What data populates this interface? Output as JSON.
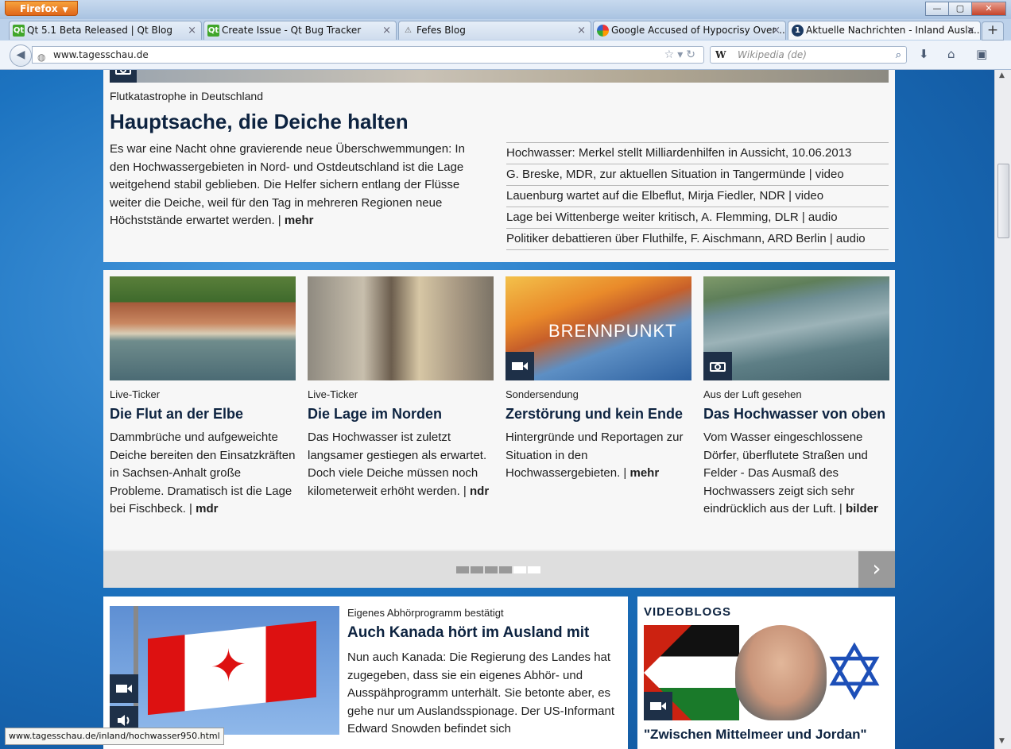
{
  "browser": {
    "menu_label": "Firefox",
    "window_controls": {
      "minimize": "—",
      "maximize": "▢",
      "close": "✕"
    },
    "tabs": [
      {
        "label": "Qt 5.1 Beta Released | Qt Blog",
        "icon": "qt-icon"
      },
      {
        "label": "Create Issue - Qt Bug Tracker",
        "icon": "qt-icon"
      },
      {
        "label": "Fefes Blog",
        "icon": "fefe-icon"
      },
      {
        "label": "Google Accused of Hypocrisy Over ...",
        "icon": "nbc-icon"
      },
      {
        "label": "Aktuelle Nachrichten - Inland Ausla...",
        "icon": "tagesschau-icon"
      }
    ],
    "new_tab_label": "+",
    "url": "www.tagesschau.de",
    "search_engine": "W",
    "search_placeholder": "Wikipedia (de)",
    "status_url": "www.tagesschau.de/inland/hochwasser950.html"
  },
  "lead": {
    "kicker": "Flutkatastrophe in Deutschland",
    "headline": "Hauptsache, die Deiche halten",
    "teaser": "Es war eine Nacht ohne gravierende neue Überschwemmungen: In den Hochwassergebieten in Nord- und Ostdeutschland ist die Lage weitgehend stabil geblieben. Die Helfer sichern entlang der Flüsse weiter die Deiche, weil für den Tag in mehreren Regionen neue Höchststände erwartet werden. |",
    "more": "mehr",
    "related": [
      "Hochwasser: Merkel stellt Milliardenhilfen in Aussicht, 10.06.2013",
      "G. Breske, MDR, zur aktuellen Situation in Tangermünde | video",
      "Lauenburg wartet auf die Elbeflut, Mirja Fiedler, NDR | video",
      "Lage bei Wittenberge weiter kritisch, A. Flemming, DLR | audio",
      "Politiker debattieren über Fluthilfe, F. Aischmann, ARD Berlin | audio"
    ]
  },
  "cards": [
    {
      "kicker": "Live-Ticker",
      "title": "Die Flut an der Elbe",
      "teaser": "Dammbrüche und aufgeweichte Deiche bereiten den Einsatzkräften in Sachsen-Anhalt große Probleme. Dramatisch ist die Lage bei Fischbeck. |",
      "more": "mdr"
    },
    {
      "kicker": "Live-Ticker",
      "title": "Die Lage im Norden",
      "teaser": "Das Hochwasser ist zuletzt langsamer gestiegen als erwartet. Doch viele Deiche müssen noch kilometerweit erhöht werden. |",
      "more": "ndr"
    },
    {
      "kicker": "Sondersendung",
      "title": "Zerstörung und kein Ende",
      "teaser": "Hintergründe und Reportagen zur Situation in den Hochwassergebieten. |",
      "more": "mehr",
      "image_text": "BRENNPUNKT"
    },
    {
      "kicker": "Aus der Luft gesehen",
      "title": "Das Hochwasser von oben",
      "teaser": "Vom Wasser eingeschlossene Dörfer, überflutete Straßen und Felder - Das Ausmaß des Hochwassers zeigt sich sehr eindrücklich aus der Luft. |",
      "more": "bilder"
    }
  ],
  "pager": {
    "total_pages": 6,
    "active_pages": [
      5,
      6
    ],
    "next": "›"
  },
  "canada": {
    "kicker": "Eigenes Abhörprogramm bestätigt",
    "headline": "Auch Kanada hört im Ausland mit",
    "teaser": "Nun auch Kanada: Die Regierung des Landes hat zugegeben, dass sie ein eigenes Abhör- und Ausspähprogramm unterhält. Sie betonte aber, es gehe nur um Auslandsspionage. Der US-Informant Edward Snowden befindet sich"
  },
  "videoblogs": {
    "heading": "VIDEOBLOGS",
    "caption": "\"Zwischen Mittelmeer und Jordan\""
  },
  "colors": {
    "headline": "#0d2340",
    "background_blue": "#1c73c0",
    "firefox_orange": "#e0661a"
  }
}
